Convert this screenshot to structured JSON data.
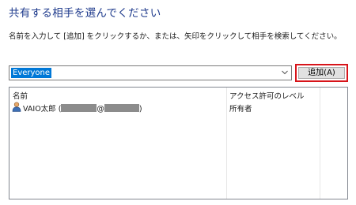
{
  "dialog": {
    "title": "共有する相手を選んでください",
    "instruction": "名前を入力して [追加] をクリックするか、または、矢印をクリックして相手を検索してください。"
  },
  "picker": {
    "selected_value": "Everyone",
    "add_button_label": "追加(A)",
    "highlight_color": "#d7141a",
    "selection_color": "#0078d7"
  },
  "list": {
    "columns": [
      "名前",
      "アクセス許可のレベル"
    ],
    "rows": [
      {
        "icon": "user-icon",
        "name_prefix": "VAIO太郎 (",
        "email_separator": "@",
        "name_suffix": ")",
        "access_level": "所有者"
      }
    ]
  }
}
